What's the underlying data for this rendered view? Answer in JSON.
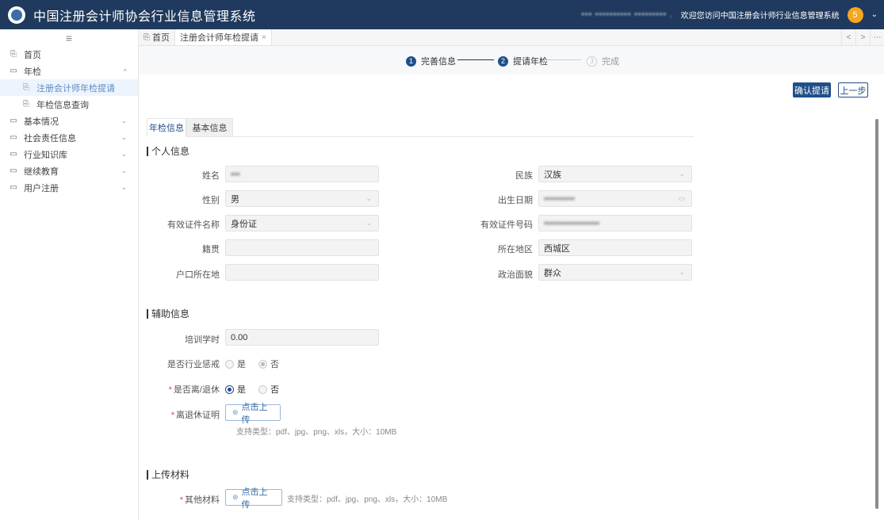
{
  "app": {
    "title": "中国注册会计师协会行业信息管理系统",
    "user_info_blurred": "▪▪▪  ▪▪▪▪▪▪▪▪▪▪ ▪▪▪▪▪▪▪▪▪ ,",
    "welcome": "欢迎您访问中国注册会计师行业信息管理系统",
    "badge_count": "5"
  },
  "sidebar": {
    "items": [
      {
        "label": "首页"
      },
      {
        "label": "年检"
      },
      {
        "label": "注册会计师年检提请"
      },
      {
        "label": "年检信息查询"
      },
      {
        "label": "基本情况"
      },
      {
        "label": "社会责任信息"
      },
      {
        "label": "行业知识库"
      },
      {
        "label": "继续教育"
      },
      {
        "label": "用户注册"
      }
    ]
  },
  "tabs": [
    {
      "label": "首页"
    },
    {
      "label": "注册会计师年检提请"
    }
  ],
  "steps": [
    {
      "num": "1",
      "label": "完善信息"
    },
    {
      "num": "2",
      "label": "提请年检"
    },
    {
      "num": "3",
      "label": "完成"
    }
  ],
  "actions": {
    "confirm": "确认提请",
    "prev": "上一步"
  },
  "form_tabs": [
    {
      "label": "年检信息"
    },
    {
      "label": "基本信息"
    }
  ],
  "personal": {
    "section": "个人信息",
    "name_label": "姓名",
    "name_value": "▪▪▪",
    "ethnicity_label": "民族",
    "ethnicity_value": "汉族",
    "gender_label": "性别",
    "gender_value": "男",
    "birth_label": "出生日期",
    "birth_value": "▪▪▪▪▪▪▪▪▪▪",
    "id_type_label": "有效证件名称",
    "id_type_value": "身份证",
    "id_no_label": "有效证件号码",
    "id_no_value": "▪▪▪▪▪▪▪▪▪▪▪▪▪▪▪▪▪▪",
    "native_label": "籍贯",
    "native_value": "",
    "region_label": "所在地区",
    "region_value": "西城区",
    "hukou_label": "户口所在地",
    "hukou_value": "",
    "political_label": "政治面貌",
    "political_value": "群众"
  },
  "aux": {
    "section": "辅助信息",
    "training_label": "培训学时",
    "training_value": "0.00",
    "discipline_label": "是否行业惩戒",
    "discipline_yes": "是",
    "discipline_no": "否",
    "retired_label": "是否离/退休",
    "retired_yes": "是",
    "retired_no": "否",
    "proof_label": "离退休证明",
    "upload_label": "点击上传",
    "upload_hint": "支持类型：pdf、jpg、png、xls，大小：10MB"
  },
  "uploads": {
    "section": "上传材料",
    "other_label": "其他材料",
    "upload_label": "点击上传",
    "upload_hint": "支持类型：pdf、jpg、png、xls，大小：10MB"
  }
}
